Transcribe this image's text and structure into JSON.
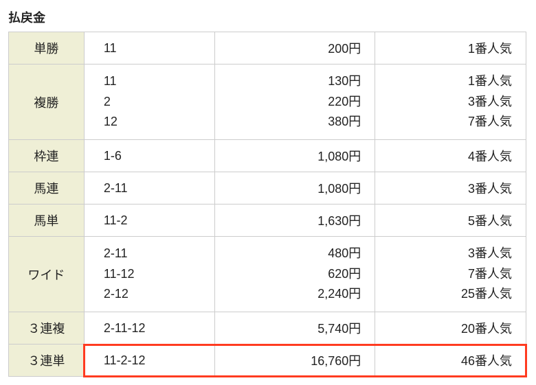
{
  "title": "払戻金",
  "rows": [
    {
      "type": "単勝",
      "combos": [
        "11"
      ],
      "payouts": [
        "200円"
      ],
      "pops": [
        "1番人気"
      ]
    },
    {
      "type": "複勝",
      "combos": [
        "11",
        "2",
        "12"
      ],
      "payouts": [
        "130円",
        "220円",
        "380円"
      ],
      "pops": [
        "1番人気",
        "3番人気",
        "7番人気"
      ]
    },
    {
      "type": "枠連",
      "combos": [
        "1-6"
      ],
      "payouts": [
        "1,080円"
      ],
      "pops": [
        "4番人気"
      ]
    },
    {
      "type": "馬連",
      "combos": [
        "2-11"
      ],
      "payouts": [
        "1,080円"
      ],
      "pops": [
        "3番人気"
      ]
    },
    {
      "type": "馬単",
      "combos": [
        "11-2"
      ],
      "payouts": [
        "1,630円"
      ],
      "pops": [
        "5番人気"
      ]
    },
    {
      "type": "ワイド",
      "combos": [
        "2-11",
        "11-12",
        "2-12"
      ],
      "payouts": [
        "480円",
        "620円",
        "2,240円"
      ],
      "pops": [
        "3番人気",
        "7番人気",
        "25番人気"
      ]
    },
    {
      "type": "３連複",
      "combos": [
        "2-11-12"
      ],
      "payouts": [
        "5,740円"
      ],
      "pops": [
        "20番人気"
      ]
    },
    {
      "type": "３連単",
      "combos": [
        "11-2-12"
      ],
      "payouts": [
        "16,760円"
      ],
      "pops": [
        "46番人気"
      ],
      "highlight": true
    }
  ]
}
